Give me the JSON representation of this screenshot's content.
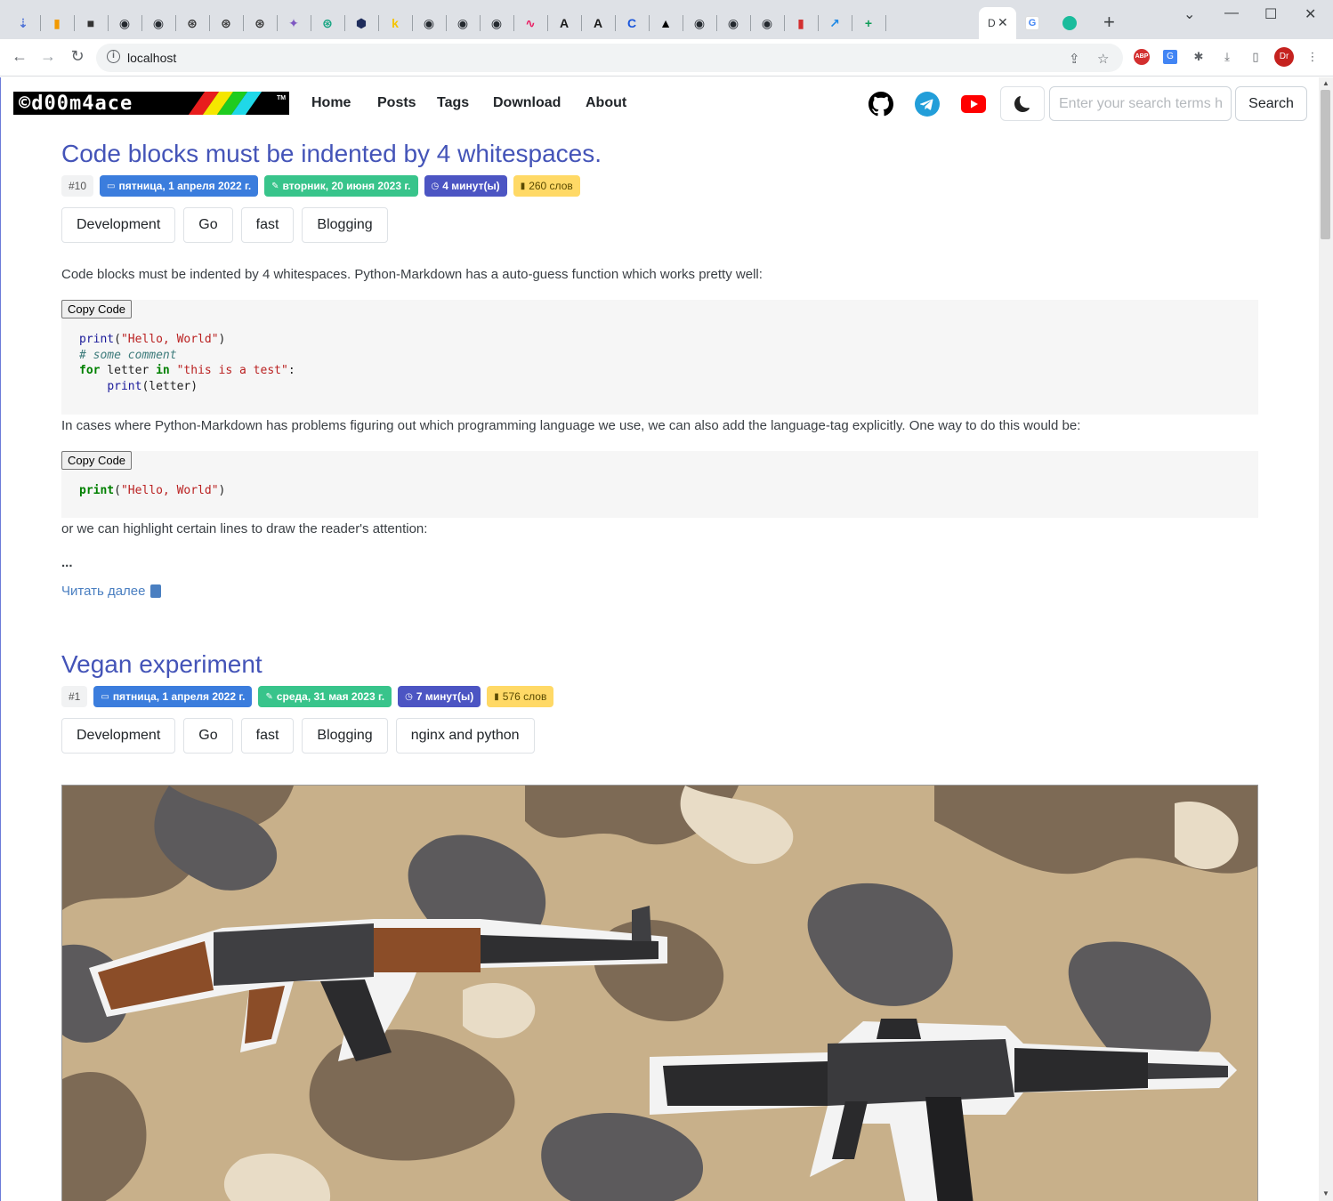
{
  "browser": {
    "active_tab_short": "D",
    "url": "localhost",
    "profile_initials": "Dr",
    "tab_favicons": [
      {
        "icon": "download-arrow",
        "color": "#4a6fd6",
        "letter": "⇣"
      },
      {
        "icon": "bar-chart",
        "color": "#f29900",
        "letter": "▮"
      },
      {
        "icon": "square-app",
        "color": "#333333",
        "letter": "■"
      },
      {
        "icon": "github",
        "color": "#24292f",
        "letter": "◉"
      },
      {
        "icon": "github",
        "color": "#24292f",
        "letter": "◉"
      },
      {
        "icon": "chatgpt",
        "color": "#333333",
        "letter": "⊛"
      },
      {
        "icon": "chatgpt",
        "color": "#333333",
        "letter": "⊛"
      },
      {
        "icon": "chatgpt",
        "color": "#333333",
        "letter": "⊛"
      },
      {
        "icon": "sparkle",
        "color": "#7e57c2",
        "letter": "✦"
      },
      {
        "icon": "openai-green",
        "color": "#10a37f",
        "letter": "⊛"
      },
      {
        "icon": "hex-shield",
        "color": "#1f2d5c",
        "letter": "⬢"
      },
      {
        "icon": "yellow-app",
        "color": "#f5c400",
        "letter": "k"
      },
      {
        "icon": "github",
        "color": "#24292f",
        "letter": "◉"
      },
      {
        "icon": "github",
        "color": "#24292f",
        "letter": "◉"
      },
      {
        "icon": "github",
        "color": "#24292f",
        "letter": "◉"
      },
      {
        "icon": "wave",
        "color": "#e91e63",
        "letter": "∿"
      },
      {
        "icon": "anthropic",
        "color": "#1a1a1a",
        "letter": "A"
      },
      {
        "icon": "anthropic",
        "color": "#1a1a1a",
        "letter": "A"
      },
      {
        "icon": "hex-blue",
        "color": "#1a56db",
        "letter": "C"
      },
      {
        "icon": "triangle",
        "color": "#000000",
        "letter": "▲"
      },
      {
        "icon": "github",
        "color": "#24292f",
        "letter": "◉"
      },
      {
        "icon": "github",
        "color": "#24292f",
        "letter": "◉"
      },
      {
        "icon": "github",
        "color": "#24292f",
        "letter": "◉"
      },
      {
        "icon": "red-bars",
        "color": "#d32f2f",
        "letter": "▮"
      },
      {
        "icon": "trend",
        "color": "#1e88e5",
        "letter": "↗"
      },
      {
        "icon": "plus-green",
        "color": "#0f9d58",
        "letter": "+"
      }
    ]
  },
  "site": {
    "logo_text": "©d00m4ace",
    "logo_tm": "TM",
    "nav": [
      "Home",
      "Posts",
      "Tags",
      "Download",
      "About"
    ],
    "search_placeholder": "Enter your search terms h",
    "search_button": "Search"
  },
  "posts": [
    {
      "title": "Code blocks must be indented by 4 whitespaces.",
      "id": "#10",
      "published": "пятница, 1 апреля 2022 г.",
      "updated": "вторник, 20 июня 2023 г.",
      "read_time": "4 минут(ы)",
      "words": "260 слов",
      "tags": [
        "Development",
        "Go",
        "fast",
        "Blogging"
      ],
      "para1": "Code blocks must be indented by 4 whitespaces. Python-Markdown has a auto-guess function which works pretty well:",
      "copy_label": "Copy Code",
      "code1": [
        {
          "parts": [
            [
              "nm",
              "print"
            ],
            [
              "",
              "("
            ],
            [
              "st",
              "\"Hello, World\""
            ],
            [
              "",
              ")"
            ]
          ]
        },
        {
          "parts": [
            [
              "cm",
              "# some comment"
            ]
          ]
        },
        {
          "parts": [
            [
              "kw",
              "for"
            ],
            [
              "",
              " letter "
            ],
            [
              "kw",
              "in"
            ],
            [
              "",
              " "
            ],
            [
              "st",
              "\"this is a test\""
            ],
            [
              "",
              ":"
            ]
          ]
        },
        {
          "parts": [
            [
              "",
              "    "
            ],
            [
              "nm",
              "print"
            ],
            [
              "",
              "(letter)"
            ]
          ]
        }
      ],
      "para2": "In cases where Python-Markdown has problems figuring out which programming language we use, we can also add the language-tag explicitly. One way to do this would be:",
      "code2": [
        {
          "parts": [
            [
              "kw",
              "print"
            ],
            [
              "",
              "("
            ],
            [
              "st",
              "\"Hello, World\""
            ],
            [
              "",
              ")"
            ]
          ]
        }
      ],
      "para3": "or we can highlight certain lines to draw the reader's attention:",
      "ellipsis": "...",
      "read_more": "Читать далее"
    },
    {
      "title": "Vegan experiment",
      "id": "#1",
      "published": "пятница, 1 апреля 2022 г.",
      "updated": "среда, 31 мая 2023 г.",
      "read_time": "7 минут(ы)",
      "words": "576 слов",
      "tags": [
        "Development",
        "Go",
        "fast",
        "Blogging",
        "nginx and python"
      ]
    }
  ],
  "colors": {
    "title_link": "#4454b8",
    "badge_published": "#3b7ddd",
    "badge_updated": "#38c48b",
    "badge_time": "#4c55c3",
    "badge_words": "#ffd966"
  }
}
